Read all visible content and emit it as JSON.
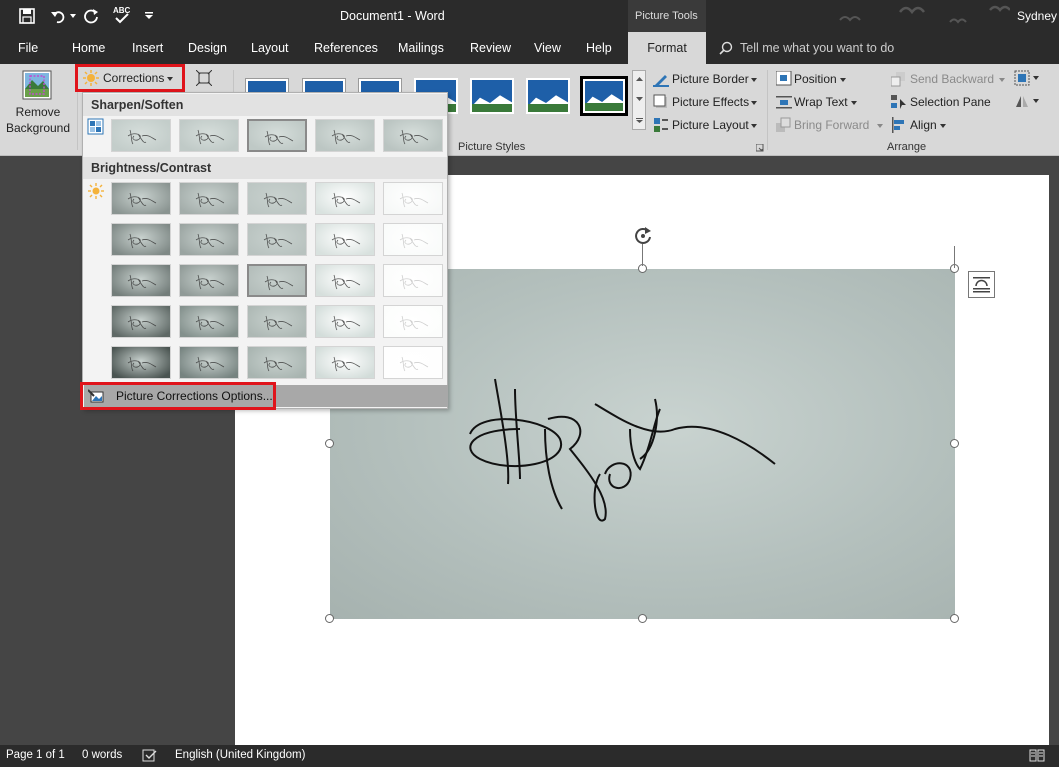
{
  "titlebar": {
    "document_title": "Document1  -  Word",
    "context_label": "Picture Tools",
    "user": "Sydney"
  },
  "tabs": [
    "File",
    "Home",
    "Insert",
    "Design",
    "Layout",
    "References",
    "Mailings",
    "Review",
    "View",
    "Help",
    "Format"
  ],
  "active_tab": "Format",
  "tell_me": "Tell me what you want to do",
  "ribbon": {
    "remove_background": [
      "Remove",
      "Background"
    ],
    "corrections": "Corrections",
    "picture_styles_label": "Picture Styles",
    "picture_border": "Picture Border",
    "picture_effects": "Picture Effects",
    "picture_layout": "Picture Layout",
    "position": "Position",
    "wrap_text": "Wrap Text",
    "bring_forward": "Bring Forward",
    "send_backward": "Send Backward",
    "selection_pane": "Selection Pane",
    "align": "Align",
    "arrange_label": "Arrange"
  },
  "dropdown": {
    "sharpen_header": "Sharpen/Soften",
    "brightness_header": "Brightness/Contrast",
    "options_label": "Picture Corrections Options...",
    "sharpen_selected_index": 2,
    "brightness_selected": {
      "row": 2,
      "col": 2
    }
  },
  "status": {
    "page": "Page 1 of 1",
    "words": "0 words",
    "language": "English (United Kingdom)"
  },
  "colors": {
    "dark_bar": "#2b2b2b",
    "ribbon": "#d8d8d8",
    "highlight_red": "#e0141b",
    "workspace": "#454545"
  }
}
